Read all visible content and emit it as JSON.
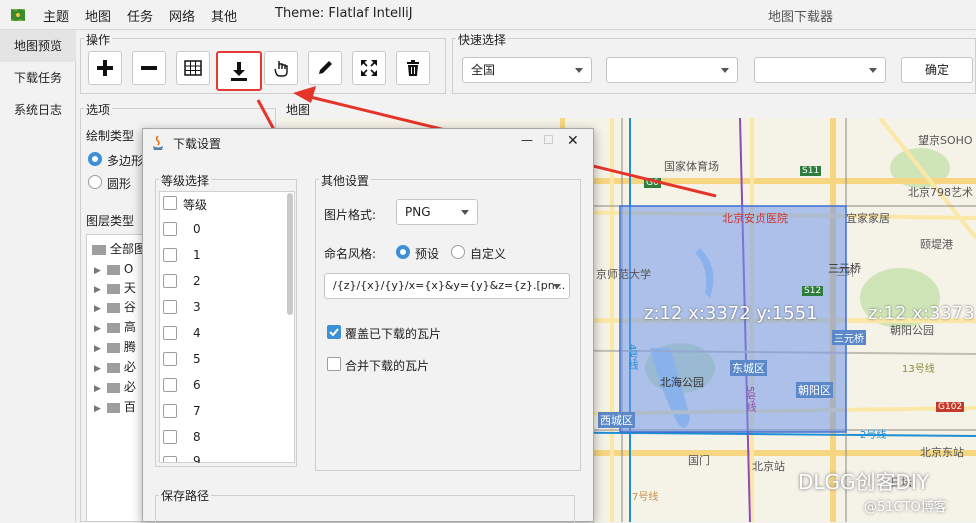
{
  "menu": {
    "items": [
      "主题",
      "地图",
      "任务",
      "网络",
      "其他"
    ],
    "theme_label": "Theme: Flatlaf IntelliJ",
    "window_title": "地图下载器"
  },
  "nav": {
    "items": [
      "地图预览",
      "下载任务",
      "系统日志"
    ]
  },
  "ops": {
    "title": "操作"
  },
  "quick": {
    "title": "快速选择",
    "combo1": "全国",
    "combo2": "",
    "combo3": "",
    "confirm": "确定"
  },
  "options": {
    "title": "选项",
    "draw_type_label": "绘制类型",
    "draw_opt1": "多边形",
    "draw_opt2": "圆形",
    "layer_label": "图层类型",
    "tree": [
      "全部图层",
      "O",
      "天",
      "谷",
      "高",
      "腾",
      "必",
      "必",
      "百"
    ]
  },
  "map": {
    "title": "地图",
    "tile1": "z:12 x:3372 y:1551",
    "tile2": "z:12 x:3373",
    "labels": [
      "国家体育场",
      "北京安贞医院",
      "京师范大学",
      "东城区",
      "北海公园",
      "朝阳区",
      "西城区",
      "三元桥",
      "朝阳公园",
      "颐堤港",
      "北京798艺术",
      "望京SOHO",
      "宜家家居",
      "三元桥",
      "北京站",
      "G6",
      "G102",
      "S12",
      "S11",
      "三环",
      "2号线",
      "4号线",
      "5号线",
      "13号线",
      "7号线",
      "北京东站",
      "国门",
      "日坛",
      "DLGG创客DIY",
      "@51CTO博客"
    ]
  },
  "dialog": {
    "title": "下载设置",
    "level_title": "等级选择",
    "level_header": "等级",
    "levels": [
      "0",
      "1",
      "2",
      "3",
      "4",
      "5",
      "6",
      "7",
      "8",
      "9"
    ],
    "other_title": "其他设置",
    "format_label": "图片格式:",
    "format_value": "PNG",
    "naming_label": "命名风格:",
    "naming_opt1": "预设",
    "naming_opt2": "自定义",
    "pattern": "/{z}/{x}/{y}/x={x}&y={y}&z={z}.[pn...",
    "overwrite": "覆盖已下载的瓦片",
    "merge": "合并下载的瓦片",
    "save_title": "保存路径",
    "min_label": "—",
    "max_label": "☐",
    "close_label": "✕"
  }
}
